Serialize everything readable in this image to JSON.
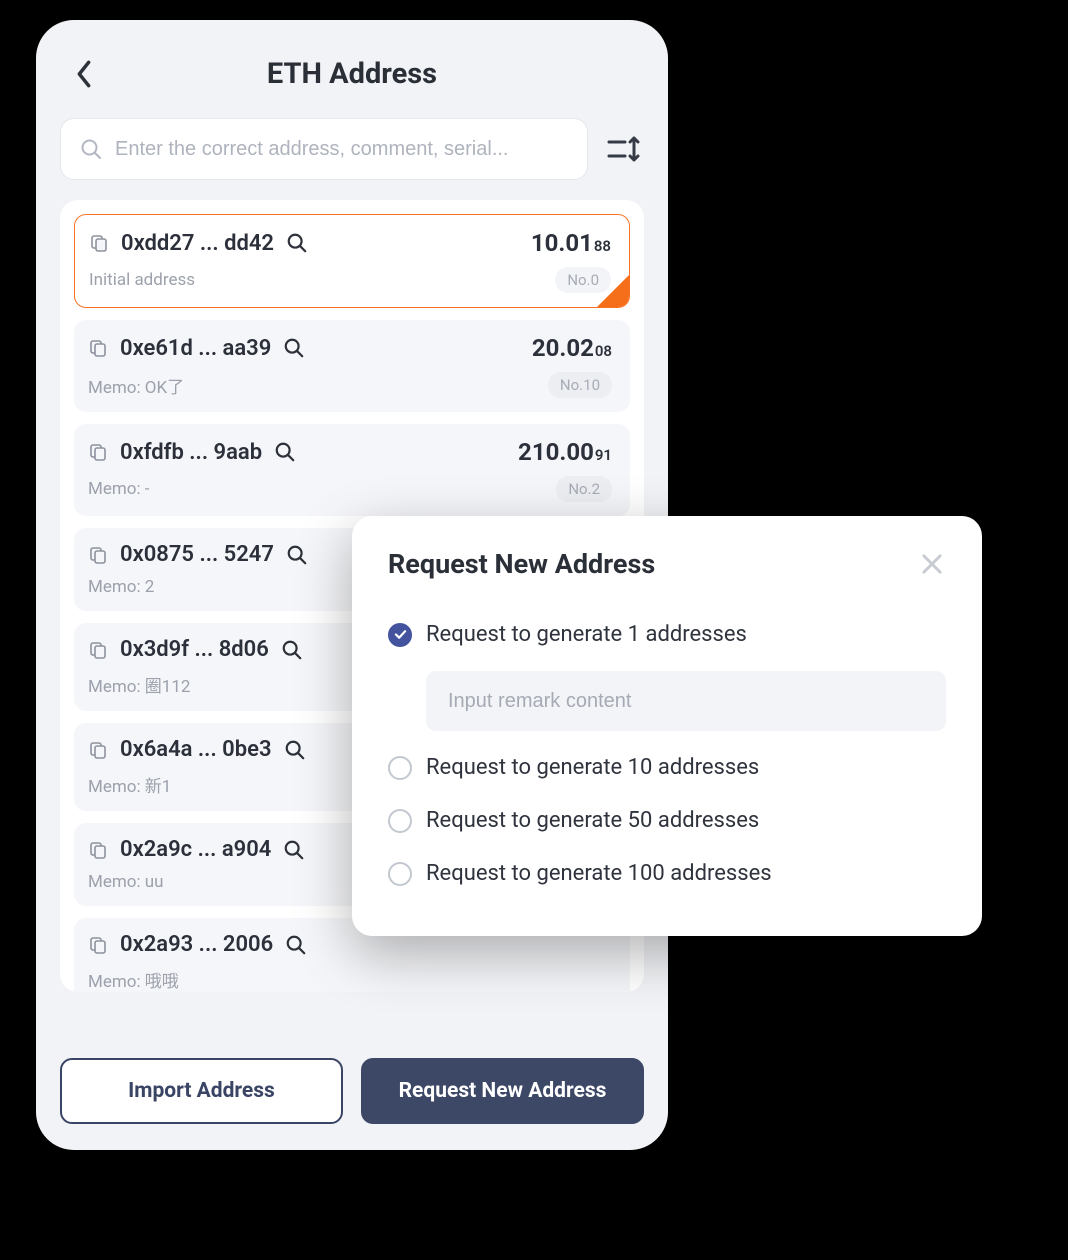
{
  "header": {
    "title": "ETH Address"
  },
  "search": {
    "placeholder": "Enter the correct address, comment, serial..."
  },
  "addresses": [
    {
      "addr": "0xdd27 ... dd42",
      "balance": "10.01",
      "balance_sub": "88",
      "memo": "Initial address",
      "no": "No.0",
      "selected": true
    },
    {
      "addr": "0xe61d ... aa39",
      "balance": "20.02",
      "balance_sub": "08",
      "memo": "Memo: OK了",
      "no": "No.10",
      "selected": false
    },
    {
      "addr": "0xfdfb ... 9aab",
      "balance": "210.00",
      "balance_sub": "91",
      "memo": "Memo: -",
      "no": "No.2",
      "selected": false
    },
    {
      "addr": "0x0875 ... 5247",
      "balance": "",
      "balance_sub": "",
      "memo": "Memo: 2",
      "no": "",
      "selected": false
    },
    {
      "addr": "0x3d9f ... 8d06",
      "balance": "",
      "balance_sub": "",
      "memo": "Memo: 圈112",
      "no": "",
      "selected": false
    },
    {
      "addr": "0x6a4a ... 0be3",
      "balance": "",
      "balance_sub": "",
      "memo": "Memo: 新1",
      "no": "",
      "selected": false
    },
    {
      "addr": "0x2a9c ... a904",
      "balance": "",
      "balance_sub": "",
      "memo": "Memo: uu",
      "no": "",
      "selected": false
    },
    {
      "addr": "0x2a93 ... 2006",
      "balance": "",
      "balance_sub": "",
      "memo": "Memo: 哦哦",
      "no": "",
      "selected": false
    }
  ],
  "footer": {
    "import_label": "Import Address",
    "request_label": "Request New Address"
  },
  "modal": {
    "title": "Request New Address",
    "remark_placeholder": "Input remark content",
    "options": [
      {
        "label": "Request to generate 1 addresses",
        "checked": true,
        "show_remark": true
      },
      {
        "label": "Request to generate 10 addresses",
        "checked": false,
        "show_remark": false
      },
      {
        "label": "Request to generate 50 addresses",
        "checked": false,
        "show_remark": false
      },
      {
        "label": "Request to generate 100 addresses",
        "checked": false,
        "show_remark": false
      }
    ]
  }
}
